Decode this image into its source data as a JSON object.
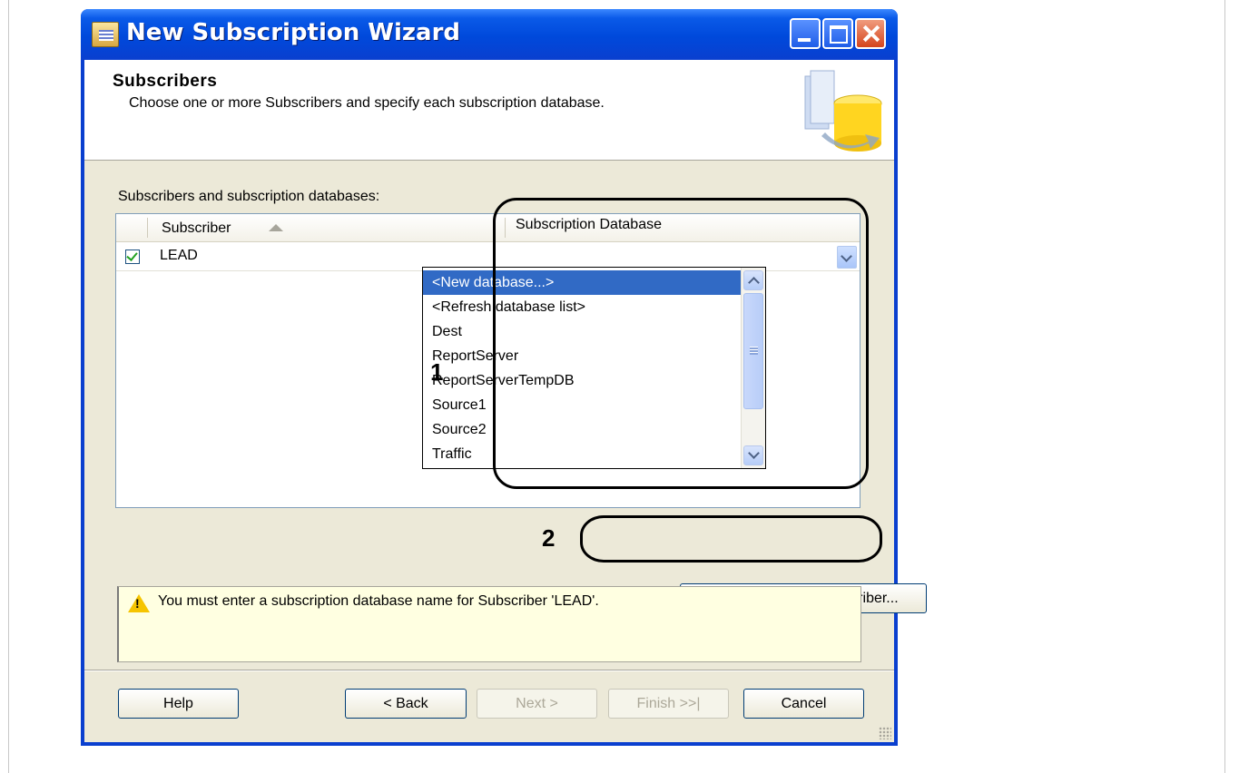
{
  "window": {
    "title": "New Subscription Wizard"
  },
  "header": {
    "title": "Subscribers",
    "description": "Choose one or more Subscribers and specify each subscription database."
  },
  "list": {
    "label": "Subscribers and subscription databases:",
    "columns": {
      "subscriber": "Subscriber",
      "database": "Subscription Database"
    },
    "rows": [
      {
        "checked": true,
        "subscriber": "LEAD",
        "database": ""
      }
    ]
  },
  "dropdown": {
    "items": [
      "<New database...>",
      "<Refresh database list>",
      "Dest",
      "ReportServer",
      "ReportServerTempDB",
      "Source1",
      "Source2",
      "Traffic"
    ],
    "selected_index": 0
  },
  "callouts": {
    "one": "1",
    "two": "2"
  },
  "add_button": "Add SQL Server Subscriber...",
  "warning": "You must enter a subscription database name for Subscriber 'LEAD'.",
  "buttons": {
    "help": "Help",
    "back": "< Back",
    "next": "Next >",
    "finish": "Finish >>|",
    "cancel": "Cancel"
  },
  "colors": {
    "selection": "#316ac5",
    "title_bar": "#0a3fcf",
    "warning_bg": "#ffffe1"
  }
}
